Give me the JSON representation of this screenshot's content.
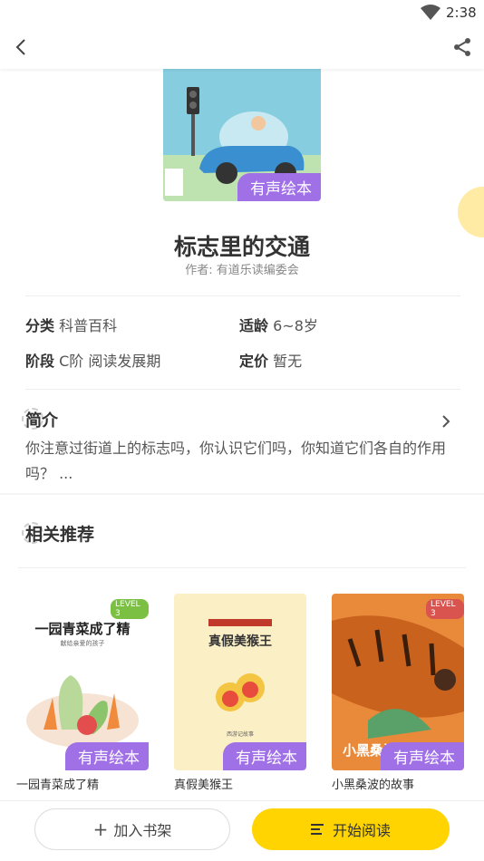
{
  "status": {
    "time": "2:38"
  },
  "book": {
    "title": "标志里的交通",
    "author": "作者: 有道乐读编委会",
    "badge": "有声绘本",
    "category_label": "分类",
    "category": "科普百科",
    "age_label": "适龄",
    "age": "6~8岁",
    "stage_label": "阶段",
    "stage": "C阶 阅读发展期",
    "price_label": "定价",
    "price": "暂无"
  },
  "intro": {
    "heading": "简介",
    "text": "你注意过街道上的标志吗，你认识它们吗，你知道它们各自的作用吗？ ..."
  },
  "related": {
    "heading": "相关推荐",
    "items": [
      {
        "title": "一园青菜成了精",
        "cover_text": "一园青菜成了精",
        "cover_sub": "献给亲爱的孩子",
        "level": "LEVEL 3",
        "badge": "有声绘本"
      },
      {
        "title": "真假美猴王",
        "cover_text": "真假美猴王",
        "cover_sub": "西游记故事",
        "badge": "有声绘本"
      },
      {
        "title": "小黑桑波的故事",
        "cover_text": "小黑桑波的故事",
        "level": "LEVEL 3",
        "badge": "有声绘本"
      }
    ]
  },
  "actions": {
    "add_shelf": "加入书架",
    "start_read": "开始阅读"
  }
}
